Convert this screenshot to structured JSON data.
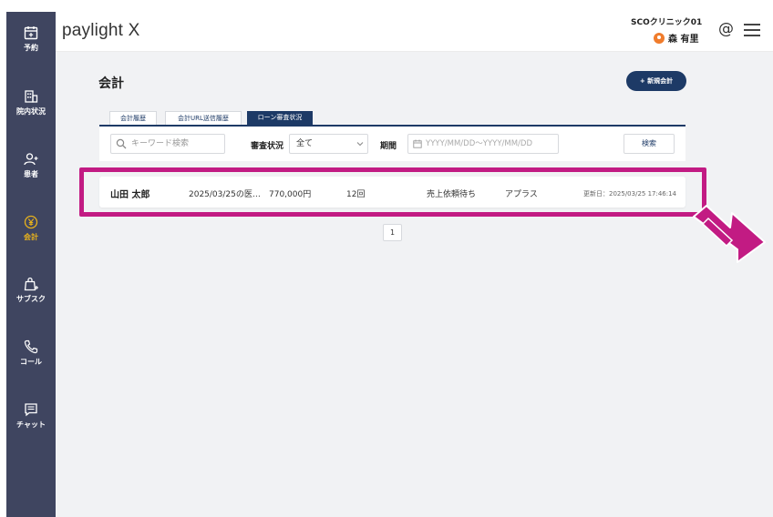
{
  "app": {
    "logo": "paylight",
    "logo_mark": "X"
  },
  "header": {
    "clinic": "SCOクリニック01",
    "user": "森 有里"
  },
  "sidebar": {
    "items": [
      {
        "label": "予約",
        "icon": "calendar-plus-icon"
      },
      {
        "label": "院内状況",
        "icon": "building-icon"
      },
      {
        "label": "患者",
        "icon": "user-plus-icon"
      },
      {
        "label": "会計",
        "icon": "yen-circle-icon",
        "active": true
      },
      {
        "label": "サブスク",
        "icon": "shopping-bag-plus-icon"
      },
      {
        "label": "コール",
        "icon": "phone-icon"
      },
      {
        "label": "チャット",
        "icon": "chat-icon"
      }
    ]
  },
  "page": {
    "title": "会計",
    "new_button": "+ 新規会計",
    "tabs": [
      {
        "label": "会計履歴",
        "active": false
      },
      {
        "label": "会計URL送信履歴",
        "active": false
      },
      {
        "label": "ローン審査状況",
        "active": true
      }
    ]
  },
  "filters": {
    "keyword_placeholder": "キーワード検索",
    "status_label": "審査状況",
    "status_value": "全て",
    "period_label": "期間",
    "period_placeholder": "YYYY/MM/DD〜YYYY/MM/DD",
    "search_button": "検索"
  },
  "records": [
    {
      "name": "山田 太郎",
      "detail": "2025/03/25の医…",
      "amount": "770,000円",
      "installments": "12回",
      "status": "売上依頼待ち",
      "company": "アプラス",
      "updated": "更新日：2025/03/25 17:46:14"
    }
  ],
  "pagination": {
    "current": "1"
  },
  "colors": {
    "sidebar": "#3f4560",
    "accent": "#1d3a66",
    "active_nav": "#e8b21c",
    "highlight": "#c21b83"
  }
}
